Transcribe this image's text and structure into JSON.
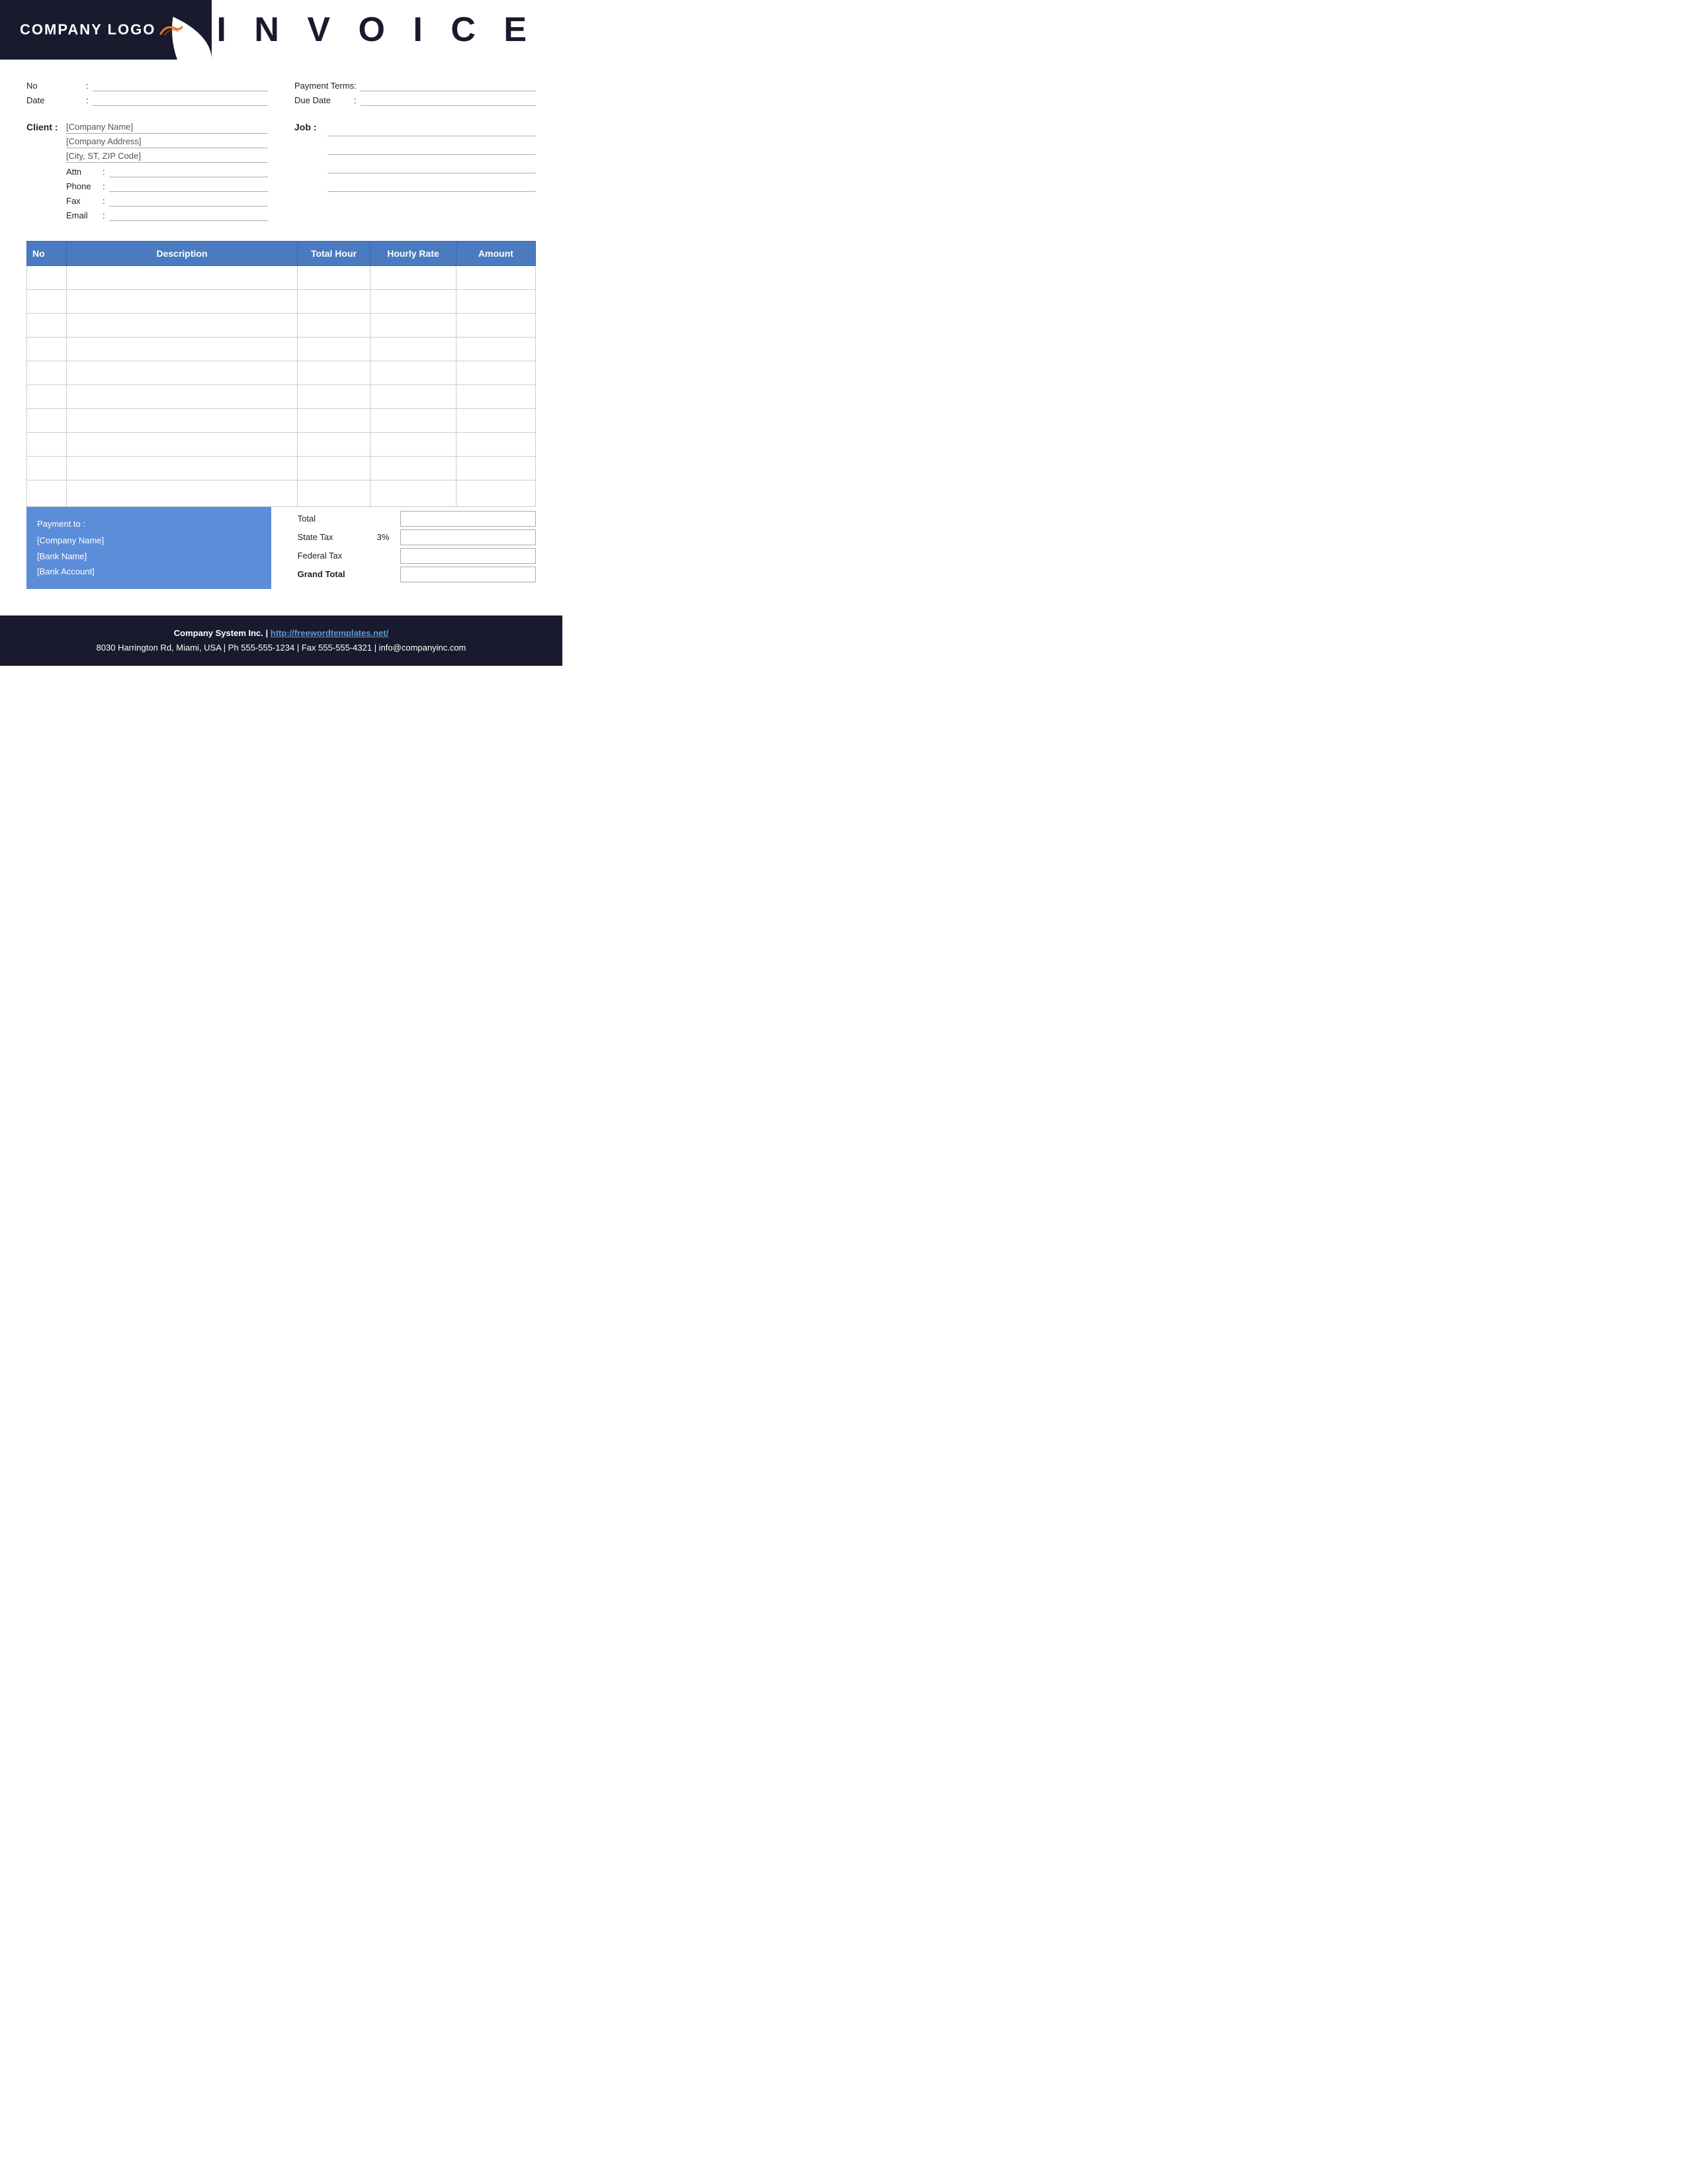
{
  "header": {
    "logo_text": "COMPANY LOGO",
    "invoice_title": "I N V O I C E"
  },
  "form": {
    "no_label": "No",
    "no_colon": ":",
    "date_label": "Date",
    "date_colon": ":",
    "payment_terms_label": "Payment  Terms",
    "payment_terms_colon": ":",
    "due_date_label": "Due Date",
    "due_date_colon": ":"
  },
  "client": {
    "label": "Client  :",
    "company_name": "[Company Name]",
    "company_address": "[Company Address]",
    "city_zip": "[City, ST, ZIP Code]",
    "attn_label": "Attn",
    "attn_colon": ":",
    "phone_label": "Phone",
    "phone_colon": ":",
    "fax_label": "Fax",
    "fax_colon": ":",
    "email_label": "Email",
    "email_colon": ":"
  },
  "job": {
    "label": "Job  :"
  },
  "table": {
    "columns": [
      "No",
      "Description",
      "Total Hour",
      "Hourly Rate",
      "Amount"
    ],
    "rows": [
      [
        "",
        "",
        "",
        "",
        ""
      ],
      [
        "",
        "",
        "",
        "",
        ""
      ],
      [
        "",
        "",
        "",
        "",
        ""
      ],
      [
        "",
        "",
        "",
        "",
        ""
      ],
      [
        "",
        "",
        "",
        "",
        ""
      ],
      [
        "",
        "",
        "",
        "",
        ""
      ],
      [
        "",
        "",
        "",
        "",
        ""
      ],
      [
        "",
        "",
        "",
        "",
        ""
      ],
      [
        "",
        "",
        "",
        "",
        ""
      ],
      [
        "",
        "",
        "",
        "",
        ""
      ]
    ]
  },
  "payment": {
    "title": "Payment to :",
    "company_name": "[Company Name]",
    "bank_name": "[Bank Name]",
    "bank_account": "[Bank Account]"
  },
  "totals": {
    "total_label": "Total",
    "state_tax_label": "State Tax",
    "state_tax_pct": "3%",
    "federal_tax_label": "Federal Tax",
    "grand_total_label": "Grand Total"
  },
  "footer": {
    "company": "Company System Inc.",
    "separator": " | ",
    "url": "http://freewordtemplates.net/",
    "address": "8030 Harrington Rd, Miami, USA | Ph 555-555-1234 | Fax 555-555-4321 | info@companyinc.com"
  }
}
